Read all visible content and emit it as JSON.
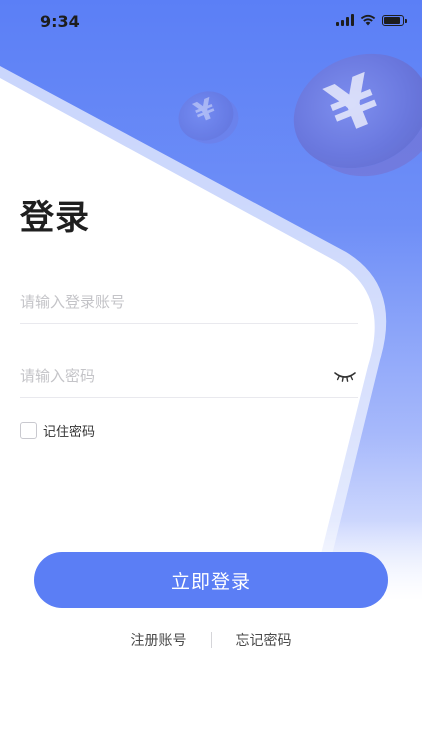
{
  "status_bar": {
    "time": "9:34",
    "icons": [
      "signal-icon",
      "wifi-icon",
      "battery-icon"
    ]
  },
  "decoration": {
    "coin_symbol": "¥"
  },
  "login": {
    "title": "登录",
    "account_placeholder": "请输入登录账号",
    "account_value": "",
    "password_placeholder": "请输入密码",
    "password_value": "",
    "remember_label": "记住密码",
    "submit_label": "立即登录"
  },
  "links": {
    "register": "注册账号",
    "forgot": "忘记密码"
  },
  "colors": {
    "accent": "#5b7ef5",
    "text": "#1f1f1f",
    "placeholder": "#c4c4c8"
  }
}
